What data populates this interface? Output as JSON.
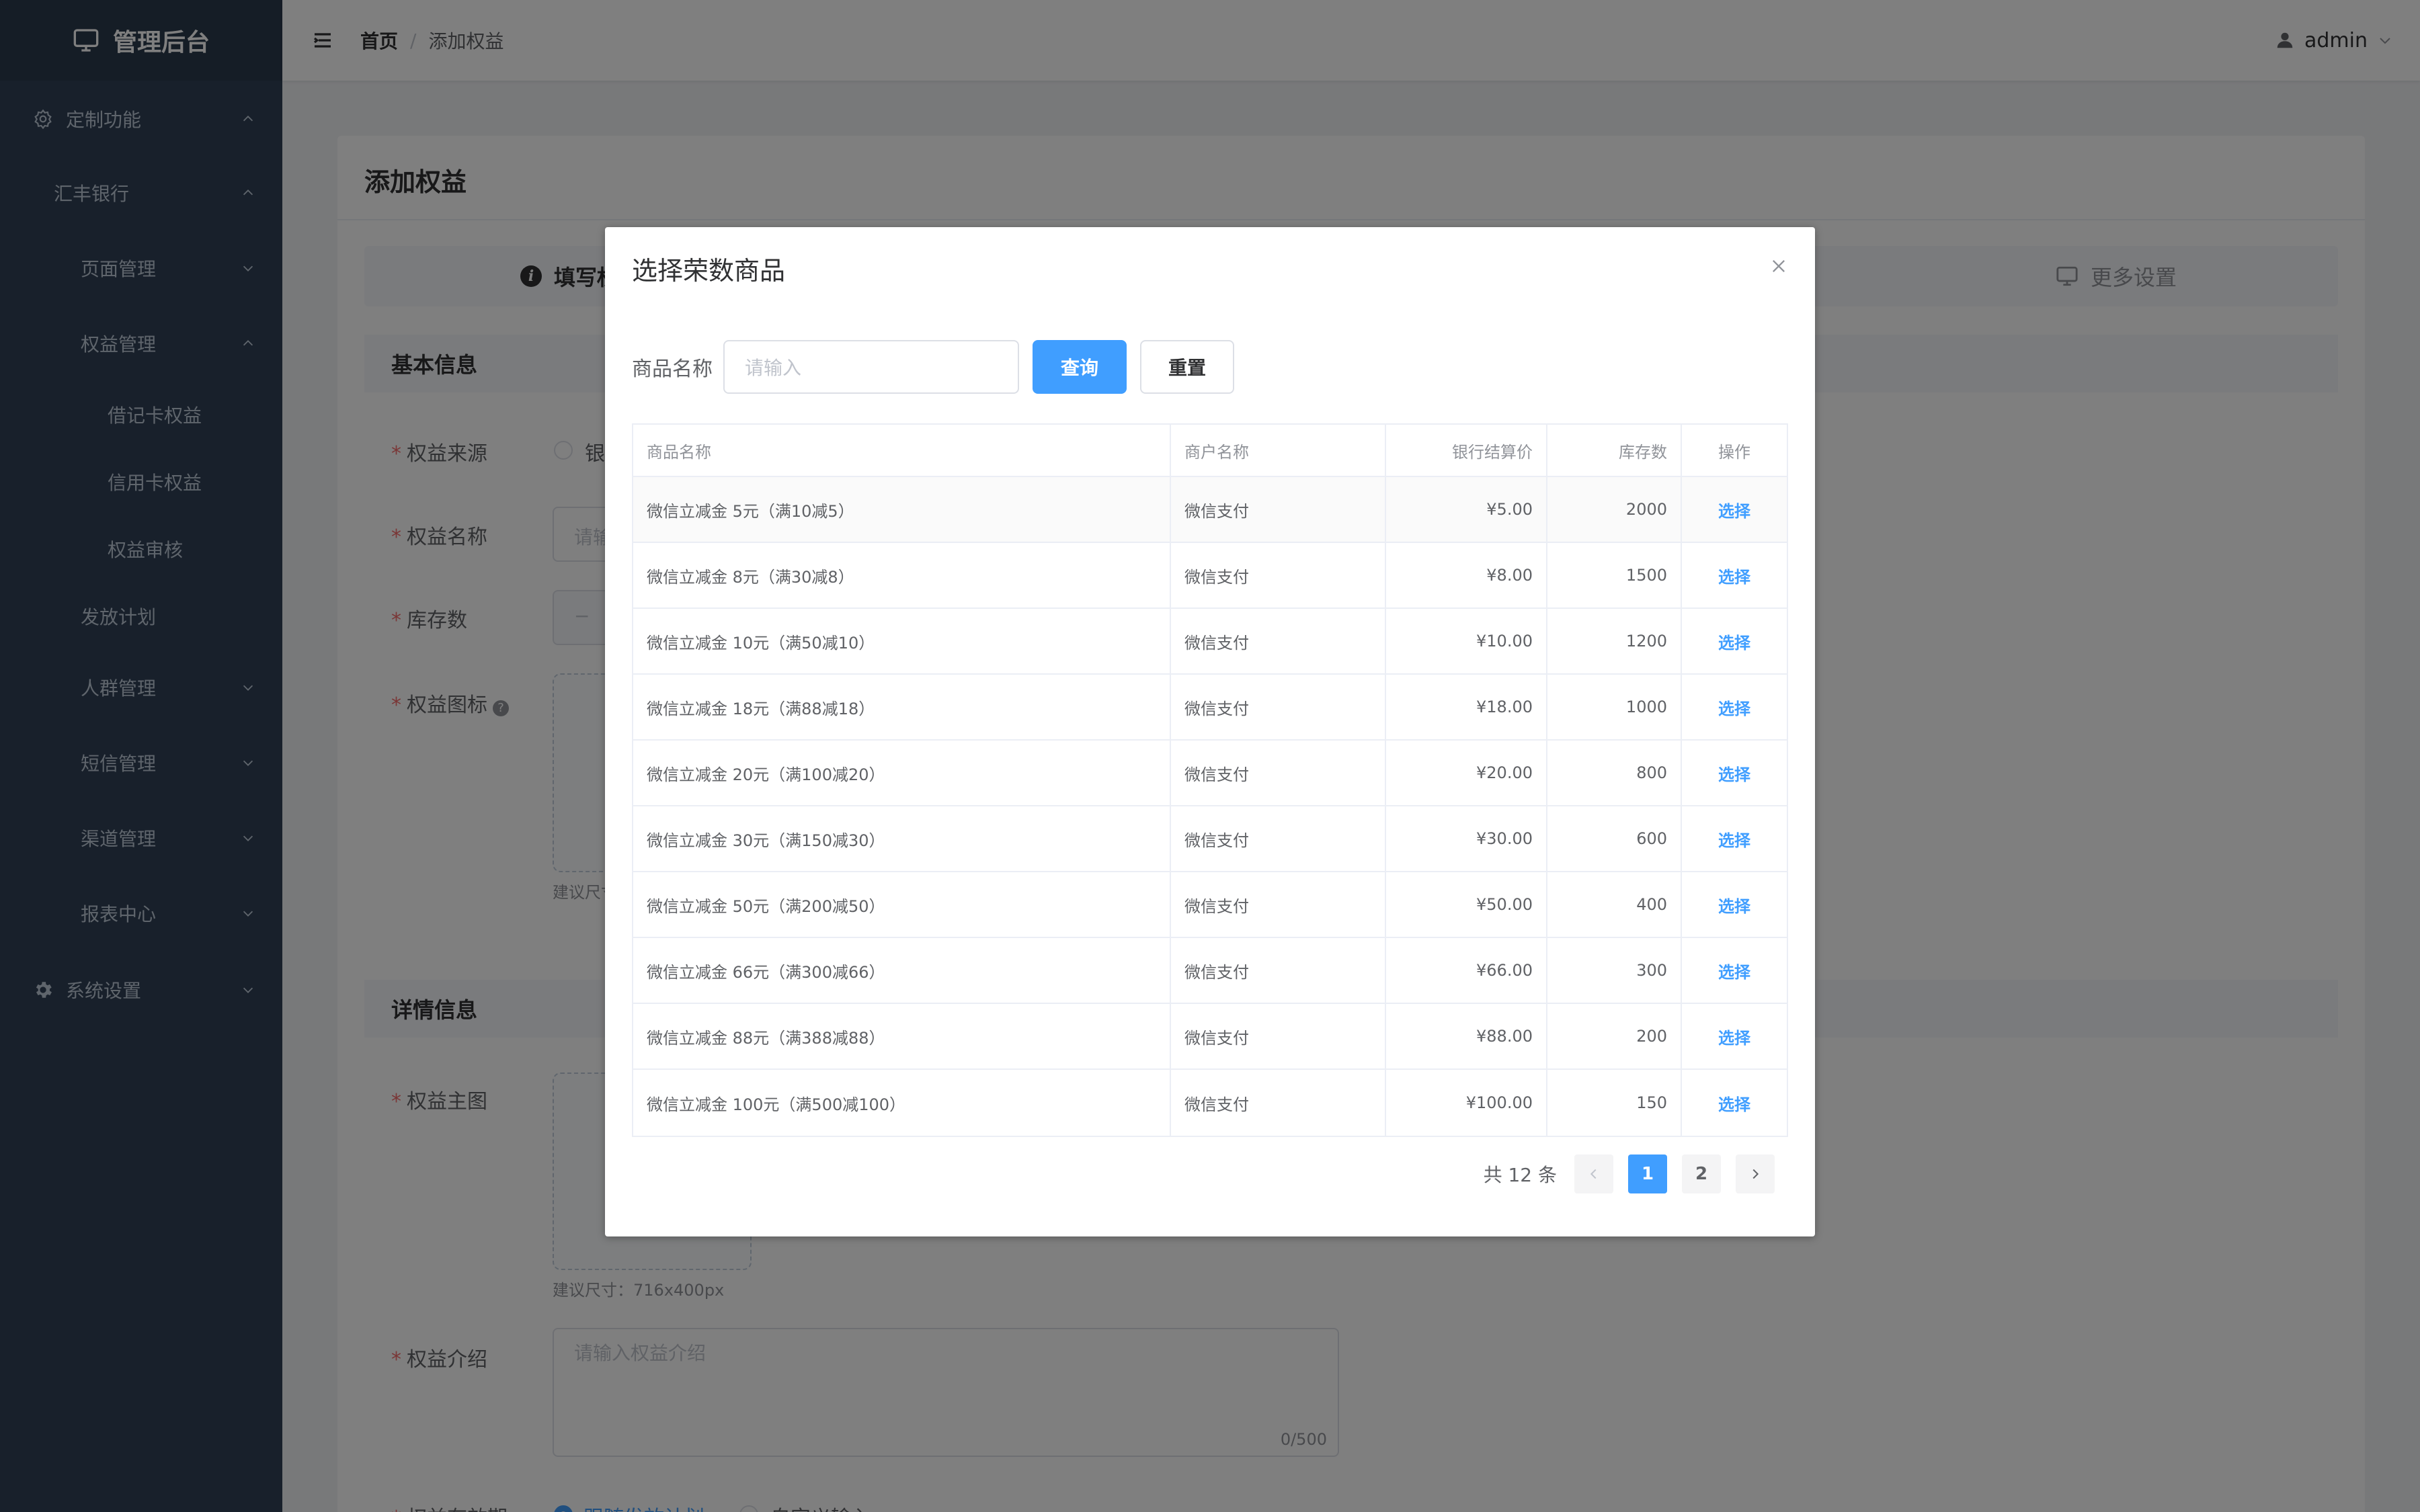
{
  "app": {
    "title": "管理后台"
  },
  "sidebar": {
    "items": [
      {
        "label": "定制功能",
        "icon": "settings-outline-icon"
      },
      {
        "label": "汇丰银行"
      },
      {
        "label": "页面管理"
      },
      {
        "label": "权益管理"
      },
      {
        "label": "借记卡权益"
      },
      {
        "label": "信用卡权益"
      },
      {
        "label": "权益审核"
      },
      {
        "label": "发放计划"
      },
      {
        "label": "人群管理"
      },
      {
        "label": "短信管理"
      },
      {
        "label": "渠道管理"
      },
      {
        "label": "报表中心"
      },
      {
        "label": "系统设置",
        "icon": "gear-icon"
      }
    ]
  },
  "header": {
    "breadcrumb": {
      "home": "首页",
      "separator": "/",
      "current": "添加权益"
    },
    "user": "admin"
  },
  "page": {
    "title": "添加权益",
    "steps": {
      "step1": "填写权益信息",
      "step3": "更多设置"
    },
    "sections": {
      "basic": "基本信息",
      "detail": "详情信息"
    },
    "labels": {
      "source": "权益来源",
      "name": "权益名称",
      "stock": "库存数",
      "icon": "权益图标",
      "main_image": "权益主图",
      "intro": "权益介绍",
      "validity": "权益有效期"
    },
    "partial": {
      "source_option": "银",
      "name_placeholder": "请输",
      "stock_minus": "−",
      "icon_hint": "建议尺寸",
      "validity_option1": "跟随发放计划",
      "validity_option2": "自定义输入"
    },
    "main_image_hint": "建议尺寸：716x400px",
    "intro_placeholder": "请输入权益介绍",
    "intro_counter": "0/500",
    "required_mark": "*"
  },
  "dialog": {
    "title": "选择荣数商品",
    "search_label": "商品名称",
    "search_placeholder": "请输入",
    "query_button": "查询",
    "reset_button": "重置",
    "columns": [
      "商品名称",
      "商户名称",
      "银行结算价",
      "库存数",
      "操作"
    ],
    "rows": [
      {
        "name": "微信立减金 5元（满10减5）",
        "merchant": "微信支付",
        "price": "¥5.00",
        "stock": "2000",
        "action": "选择"
      },
      {
        "name": "微信立减金 8元（满30减8）",
        "merchant": "微信支付",
        "price": "¥8.00",
        "stock": "1500",
        "action": "选择"
      },
      {
        "name": "微信立减金 10元（满50减10）",
        "merchant": "微信支付",
        "price": "¥10.00",
        "stock": "1200",
        "action": "选择"
      },
      {
        "name": "微信立减金 18元（满88减18）",
        "merchant": "微信支付",
        "price": "¥18.00",
        "stock": "1000",
        "action": "选择"
      },
      {
        "name": "微信立减金 20元（满100减20）",
        "merchant": "微信支付",
        "price": "¥20.00",
        "stock": "800",
        "action": "选择"
      },
      {
        "name": "微信立减金 30元（满150减30）",
        "merchant": "微信支付",
        "price": "¥30.00",
        "stock": "600",
        "action": "选择"
      },
      {
        "name": "微信立减金 50元（满200减50）",
        "merchant": "微信支付",
        "price": "¥50.00",
        "stock": "400",
        "action": "选择"
      },
      {
        "name": "微信立减金 66元（满300减66）",
        "merchant": "微信支付",
        "price": "¥66.00",
        "stock": "300",
        "action": "选择"
      },
      {
        "name": "微信立减金 88元（满388减88）",
        "merchant": "微信支付",
        "price": "¥88.00",
        "stock": "200",
        "action": "选择"
      },
      {
        "name": "微信立减金 100元（满500减100）",
        "merchant": "微信支付",
        "price": "¥100.00",
        "stock": "150",
        "action": "选择"
      }
    ],
    "pagination": {
      "total": "共 12 条",
      "pages": [
        "1",
        "2"
      ],
      "current": "1"
    }
  },
  "colors": {
    "sidebar_bg": "#304156",
    "primary": "#409eff",
    "required": "#f56c6c",
    "overlay": "rgba(0,0,0,0.5)"
  }
}
